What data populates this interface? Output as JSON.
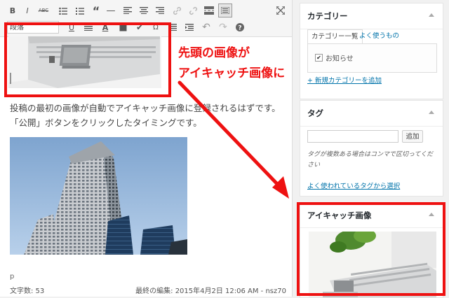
{
  "editor": {
    "format_select": "段落",
    "paragraph": "投稿の最初の画像が自動でアイキャッチ画像に登録されるはずです。「公開」ボタンをクリックしたタイミングです。",
    "path": "p",
    "word_count": "文字数: 53",
    "last_edit": "最終の編集: 2015年4月2日 12:06 AM - nsz70"
  },
  "annotation": {
    "line1": "先頭の画像が",
    "line2": "アイキャッチ画像に",
    "color": "#ee1111"
  },
  "category_box": {
    "title": "カテゴリー",
    "tab_all": "カテゴリー一覧",
    "tab_popular": "よく使うもの",
    "item_label": "お知らせ",
    "item_checked": true,
    "add_link": "+ 新規カテゴリーを追加"
  },
  "tag_box": {
    "title": "タグ",
    "input_value": "",
    "add_button": "追加",
    "hint": "タグが複数ある場合はコンマで区切ってください",
    "popular_link": "よく使われているタグから選択"
  },
  "featured_box": {
    "title": "アイキャッチ画像"
  }
}
